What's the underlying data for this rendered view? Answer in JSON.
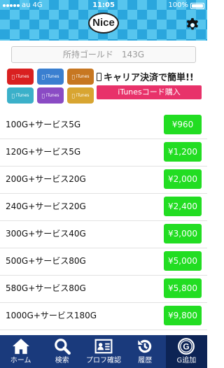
{
  "status_bar": {
    "carrier": "au",
    "network": "4G",
    "time": "11:05",
    "battery": "100%"
  },
  "header": {
    "logo_text": "Nice"
  },
  "points": {
    "text": "所持ゴールド　143G"
  },
  "banner": {
    "card_label": "iTunes",
    "title": "キャリア決済で簡単!!",
    "button": "iTunesコード購入"
  },
  "products": [
    {
      "label": "100G+サービス5G",
      "price": "¥960"
    },
    {
      "label": "120G+サービス5G",
      "price": "¥1,200"
    },
    {
      "label": "200G+サービス20G",
      "price": "¥2,000"
    },
    {
      "label": "240G+サービス20G",
      "price": "¥2,400"
    },
    {
      "label": "300G+サービス40G",
      "price": "¥3,000"
    },
    {
      "label": "500G+サービス80G",
      "price": "¥5,000"
    },
    {
      "label": "580G+サービス80G",
      "price": "¥5,800"
    },
    {
      "label": "1000G+サービス180G",
      "price": "¥9,800"
    }
  ],
  "tabs": [
    {
      "label": "ホーム",
      "icon": "home-icon"
    },
    {
      "label": "検索",
      "icon": "search-icon"
    },
    {
      "label": "プロフ確認",
      "icon": "profile-card-icon"
    },
    {
      "label": "履歴",
      "icon": "history-icon"
    },
    {
      "label": "G追加",
      "icon": "gold-add-icon"
    }
  ],
  "colors": {
    "header": "#2aa6dd",
    "price_button": "#22dd22",
    "tab_bar": "#1a3a7c",
    "banner_button": "#e8326a"
  }
}
